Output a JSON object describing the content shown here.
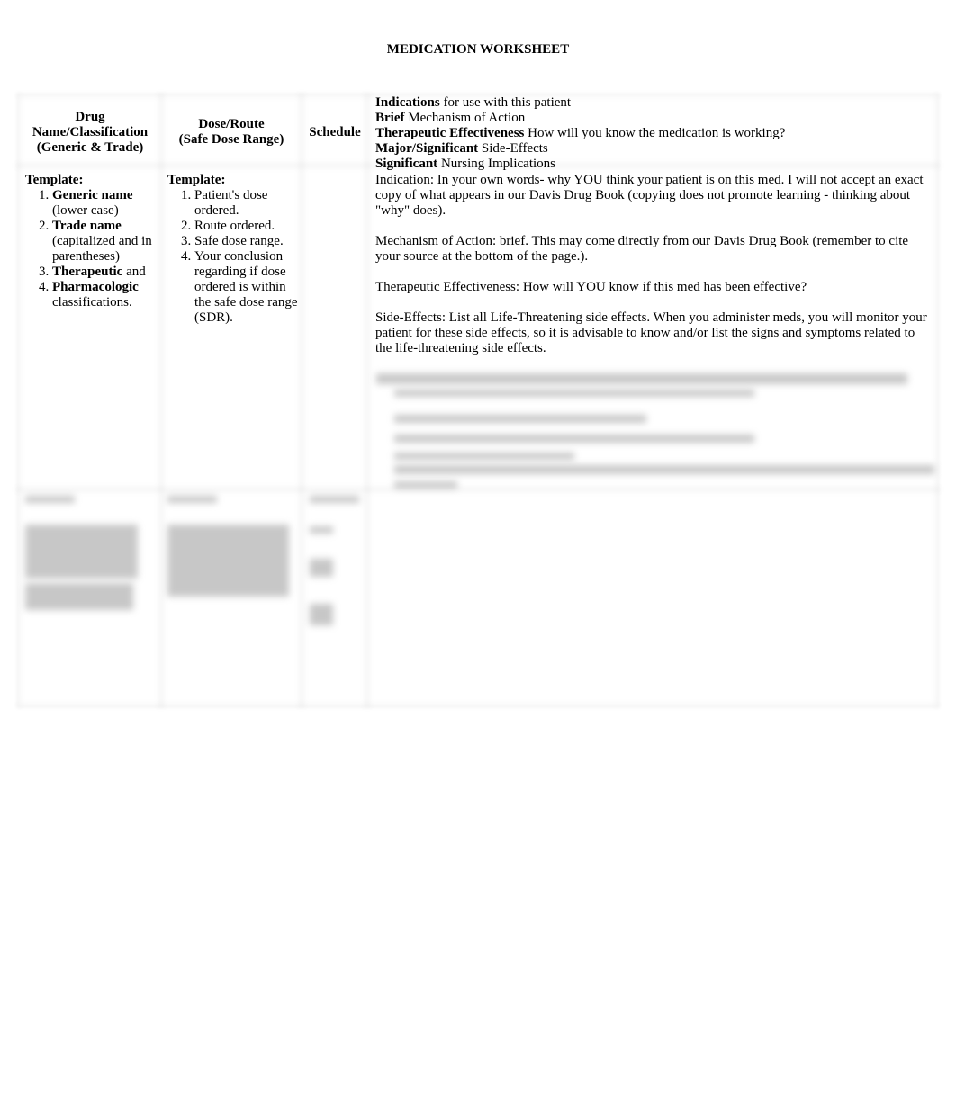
{
  "title": "MEDICATION WORKSHEET",
  "headers": {
    "drug": [
      "Drug",
      "Name/Classification",
      "(Generic & Trade)"
    ],
    "dose": [
      "Dose/Route",
      "(Safe Dose Range)"
    ],
    "schedule": "Schedule",
    "info": [
      {
        "bold": "Indications",
        "rest": " for use with this patient"
      },
      {
        "bold": "Brief",
        "rest": " Mechanism of Action"
      },
      {
        "bold": "Therapeutic Effectiveness",
        "rest": " How will you know the medication is working?"
      },
      {
        "bold": "Major/Significant",
        "rest": " Side-Effects"
      },
      {
        "bold": "Significant",
        "rest": " Nursing  Implications"
      }
    ]
  },
  "template_row": {
    "drug": {
      "label": "Template:",
      "items": [
        {
          "bold": "Generic name",
          "rest": " (lower case)"
        },
        {
          "bold": "Trade name",
          "rest": " (capitalized and in parentheses)"
        },
        {
          "bold": "Therapeutic",
          "rest": " and"
        },
        {
          "bold": "Pharmacologic",
          "rest": " classifications."
        }
      ]
    },
    "dose": {
      "label": "Template:",
      "items": [
        "Patient's dose ordered.",
        "Route ordered.",
        "Safe dose range.",
        "Your conclusion regarding if dose ordered is within the safe dose range (SDR)."
      ]
    },
    "info": [
      "Indication:  In your own words- why YOU think your patient is on this med.  I will not accept an exact copy of what appears in our Davis Drug Book (copying does not promote learning - thinking about \"why\" does).",
      "Mechanism of Action: brief. This may come directly from our Davis Drug Book (remember to cite your source at the bottom of the page.).",
      "Therapeutic Effectiveness: How will YOU know if this med has been effective?",
      "Side-Effects:  List all Life-Threatening side effects.  When you administer meds, you will monitor your patient for these side effects, so it is advisable to know and/or list the signs and symptoms related to the life-threatening side effects."
    ]
  }
}
